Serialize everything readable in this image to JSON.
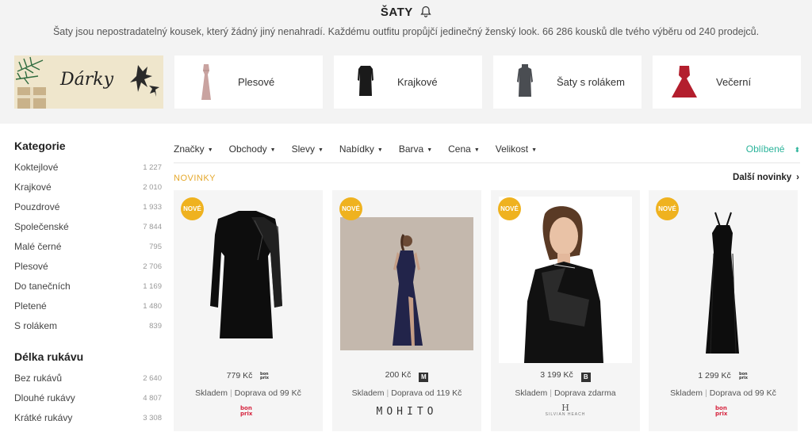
{
  "header": {
    "title": "ŠATY",
    "subtitle": "Šaty jsou nepostradatelný kousek, který žádný jiný nenahradí. Každému outfitu propůjčí jedinečný ženský look. 66 286 kousků dle tvého výběru od 240 prodejců."
  },
  "banner": {
    "label": "Dárky"
  },
  "categories": [
    {
      "label": "Plesové"
    },
    {
      "label": "Krajkové"
    },
    {
      "label": "Šaty s rolákem"
    },
    {
      "label": "Večerní"
    }
  ],
  "sidebar": {
    "section1": {
      "title": "Kategorie",
      "items": [
        {
          "label": "Koktejlové",
          "count": "1 227"
        },
        {
          "label": "Krajkové",
          "count": "2 010"
        },
        {
          "label": "Pouzdrové",
          "count": "1 933"
        },
        {
          "label": "Společenské",
          "count": "7 844"
        },
        {
          "label": "Malé černé",
          "count": "795"
        },
        {
          "label": "Plesové",
          "count": "2 706"
        },
        {
          "label": "Do tanečních",
          "count": "1 169"
        },
        {
          "label": "Pletené",
          "count": "1 480"
        },
        {
          "label": "S rolákem",
          "count": "839"
        }
      ]
    },
    "section2": {
      "title": "Délka rukávu",
      "items": [
        {
          "label": "Bez rukávů",
          "count": "2 640"
        },
        {
          "label": "Dlouhé rukávy",
          "count": "4 807"
        },
        {
          "label": "Krátké rukávy",
          "count": "3 308"
        }
      ]
    }
  },
  "filters": {
    "items": [
      "Značky",
      "Obchody",
      "Slevy",
      "Nabídky",
      "Barva",
      "Cena",
      "Velikost"
    ],
    "sort_label": "Oblíbené"
  },
  "section": {
    "label": "NOVINKY",
    "more": "Další novinky"
  },
  "products": [
    {
      "badge": "NOVÉ",
      "price": "779 Kč",
      "stock": "Skladem",
      "shipping": "Doprava od 99 Kč",
      "shop": "bonprix"
    },
    {
      "badge": "NOVÉ",
      "price": "200 Kč",
      "stock": "Skladem",
      "shipping": "Doprava od 119 Kč",
      "shop": "MOHITO",
      "shop_icon": "M"
    },
    {
      "badge": "NOVÉ",
      "price": "3 199 Kč",
      "stock": "Skladem",
      "shipping": "Doprava zdarma",
      "shop": "SILVIAN HEACH",
      "shop_icon": "B"
    },
    {
      "badge": "NOVÉ",
      "price": "1 299 Kč",
      "stock": "Skladem",
      "shipping": "Doprava od 99 Kč",
      "shop": "bonprix"
    }
  ],
  "colors": {
    "accent_green": "#2ab39a",
    "badge_yellow": "#efb21f",
    "section_orange": "#e5a82b"
  }
}
